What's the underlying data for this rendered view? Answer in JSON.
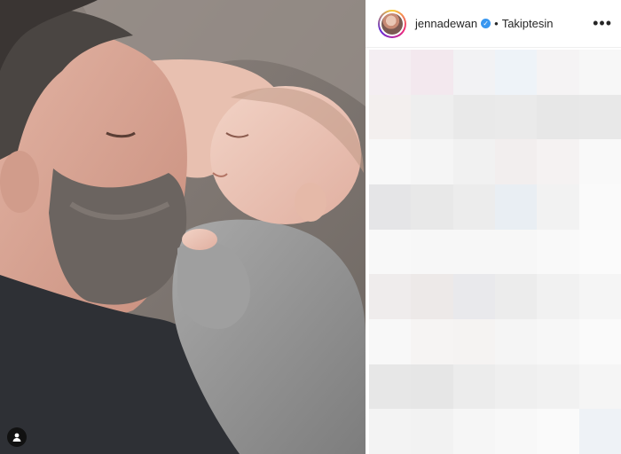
{
  "post": {
    "username": "jennadewan",
    "verified_icon": "verified-badge-icon",
    "separator": "•",
    "follow_label": "Takiptesin",
    "more_label": "•••"
  },
  "photo": {
    "description_icon": "photo-image",
    "profile_icon": "user-tag-icon"
  },
  "colors": {
    "accent_blue": "#3897f0",
    "text": "#262626",
    "background": "#ffffff"
  }
}
